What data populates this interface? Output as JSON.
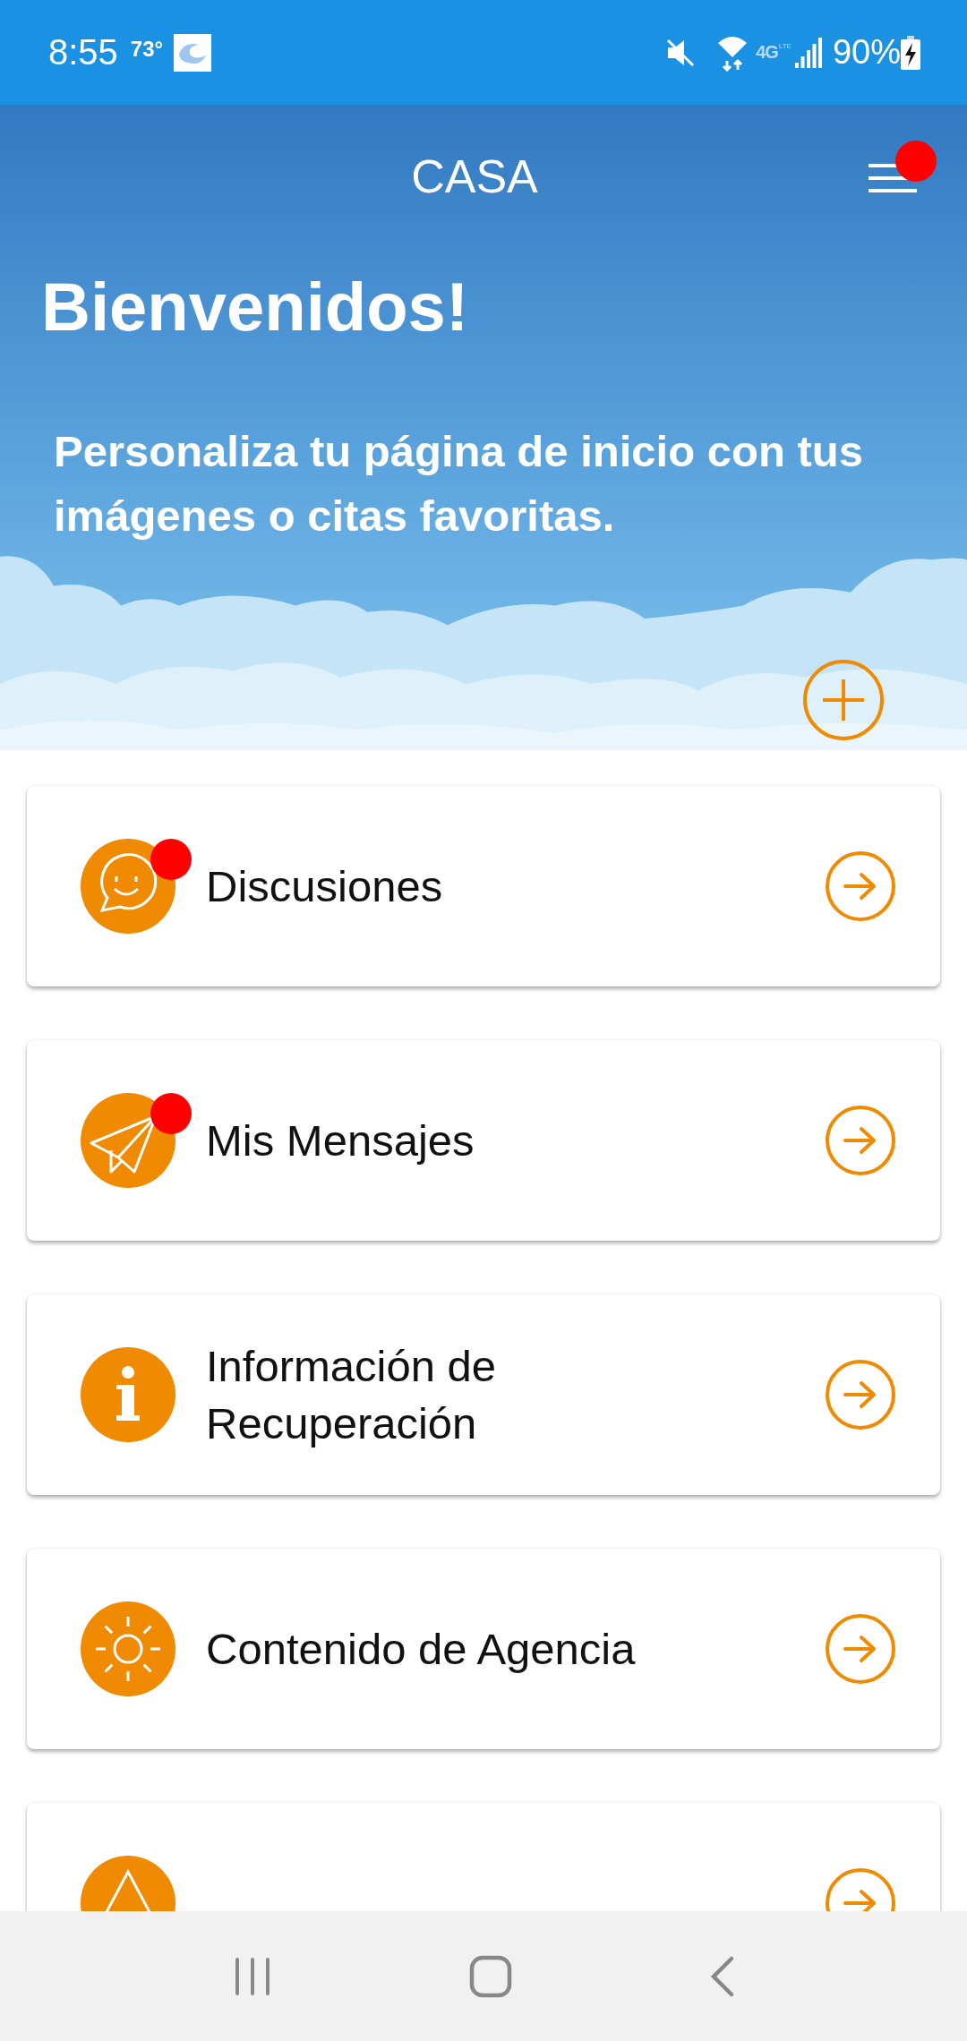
{
  "status_bar": {
    "time": "8:55",
    "temperature": "73°",
    "network": "4G",
    "network_sub": "LTE",
    "battery": "90%"
  },
  "header": {
    "title": "CASA",
    "menu_badge": true,
    "heading": "Bienvenidos!",
    "subtitle": "Personaliza tu página de inicio con tus imágenes o citas favoritas."
  },
  "cards": [
    {
      "kind": "chat",
      "label": "Discusiones",
      "badge": true
    },
    {
      "kind": "send",
      "label": "Mis Mensajes",
      "badge": true
    },
    {
      "kind": "info",
      "label": "Información de Recuperación",
      "badge": false
    },
    {
      "kind": "sun",
      "label": "Contenido de Agencia",
      "badge": false
    },
    {
      "kind": "warning",
      "badge": false
    }
  ]
}
